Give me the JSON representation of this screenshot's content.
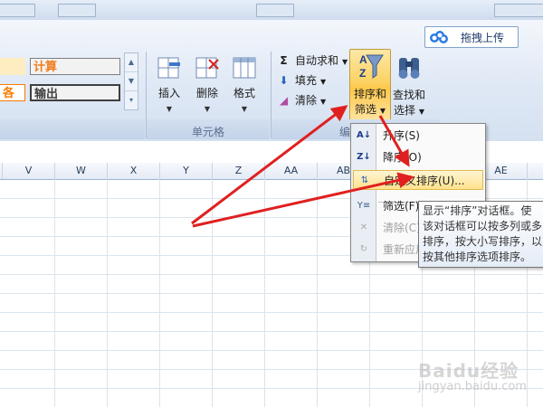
{
  "upload_button": {
    "label": "拖拽上传"
  },
  "styles": {
    "calc": "计算",
    "output": "输出",
    "left_fragment": "各"
  },
  "cells_group": {
    "label": "单元格",
    "insert": "插入",
    "delete": "删除",
    "format": "格式"
  },
  "editing_group": {
    "label_partial": "编",
    "autosum": "自动求和",
    "fill": "填充",
    "clear": "清除",
    "sort_filter_line1": "排序和",
    "sort_filter_line2": "筛选",
    "find_select_line1": "查找和",
    "find_select_line2": "选择"
  },
  "columns": [
    "V",
    "W",
    "X",
    "Y",
    "Z",
    "AA",
    "AB",
    "AE"
  ],
  "sort_menu": {
    "ascending": "升序(S)",
    "descending": "降序(O)",
    "custom": "自定义排序(U)...",
    "filter": "筛选(F)",
    "clear": "清除(C)",
    "reapply": "重新应用(Y)"
  },
  "tooltip": {
    "line1": "显示“排序”对话框。使",
    "line2": "该对话框可以按多列或多",
    "line3": "排序，按大小写排序，以",
    "line4": "按其他排序选项排序。"
  },
  "watermark": {
    "text": "Baidu经验",
    "sub": "jingyan.baidu.com"
  },
  "colors": {
    "arrow": "#e02020",
    "accent_highlight": "#ffe28c"
  }
}
